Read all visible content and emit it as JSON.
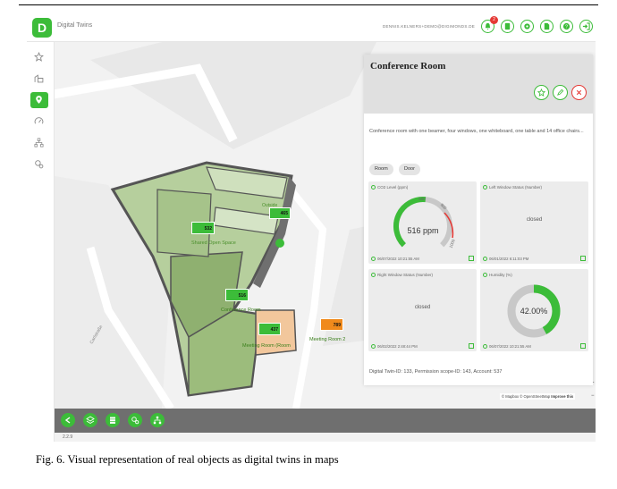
{
  "app": {
    "logo_letter": "D",
    "title": "Digital Twins",
    "user_email": "DENNIS.KELNERS+DEMO@DIGIMONDS.DE",
    "version": "2.2.9"
  },
  "topbar": {
    "notification_count": "2",
    "buttons": [
      "bell-icon",
      "document-icon",
      "gear-icon",
      "file-icon",
      "help-icon",
      "logout-icon"
    ]
  },
  "sidebar": {
    "items": [
      {
        "name": "sidebar-item-favorites",
        "icon": "star-icon",
        "active": false
      },
      {
        "name": "sidebar-item-buildings",
        "icon": "buildings-icon",
        "active": false
      },
      {
        "name": "sidebar-item-map",
        "icon": "map-pin-icon",
        "active": true
      },
      {
        "name": "sidebar-item-dashboard",
        "icon": "gauge-icon",
        "active": false
      },
      {
        "name": "sidebar-item-hierarchy",
        "icon": "hierarchy-icon",
        "active": false
      },
      {
        "name": "sidebar-item-settings",
        "icon": "gears-icon",
        "active": false
      }
    ]
  },
  "map": {
    "street_label": "Carlstraße",
    "markers": [
      {
        "value": "532",
        "label": "Shared Open Space"
      },
      {
        "value": "465",
        "label": "Outside"
      },
      {
        "value": "516",
        "label": "Conference Room"
      },
      {
        "value": "437",
        "label": "Meeting Room (Room"
      },
      {
        "value": "789",
        "label": "Meeting Room 2"
      }
    ],
    "bottom_buttons": [
      "back-icon",
      "layers-icon",
      "stack-icon",
      "gears-icon",
      "hierarchy-icon"
    ],
    "attribution_prefix": "© Mapbox © OpenStreetMap",
    "attribution_link": "Improve this"
  },
  "panel": {
    "title": "Conference Room",
    "description": "Conference room with one beamer, four windows, one whiteboard, one table and 14 office chairs...",
    "tags": [
      "Room",
      "Door"
    ],
    "cards": [
      {
        "title": "CO2 Level (ppm)",
        "value": "516 ppm",
        "fraction": 0.52,
        "timestamp": "06/07/2022 10:21:55 AM",
        "gauge_ticks": [
          "600",
          "800",
          "1000"
        ]
      },
      {
        "title": "Left Window Status (Number)",
        "value": "closed",
        "timestamp": "06/01/2022 6:11:03 PM"
      },
      {
        "title": "Right Window Status (Number)",
        "value": "closed",
        "timestamp": "06/02/2022 2:48:44 PM"
      },
      {
        "title": "Humidity (%)",
        "value": "42.00%",
        "fraction": 0.42,
        "timestamp": "06/07/2022 10:21:55 AM"
      }
    ],
    "footer": "Digital Twin-ID: 133, Permission scope-ID: 143, Account: 537"
  },
  "caption": "Fig. 6.   Visual representation of real objects as digital twins in maps",
  "colors": {
    "accent": "#3cbc39",
    "danger": "#e53935",
    "orange": "#f08a1c",
    "dark_bar": "#6f6f6f"
  }
}
